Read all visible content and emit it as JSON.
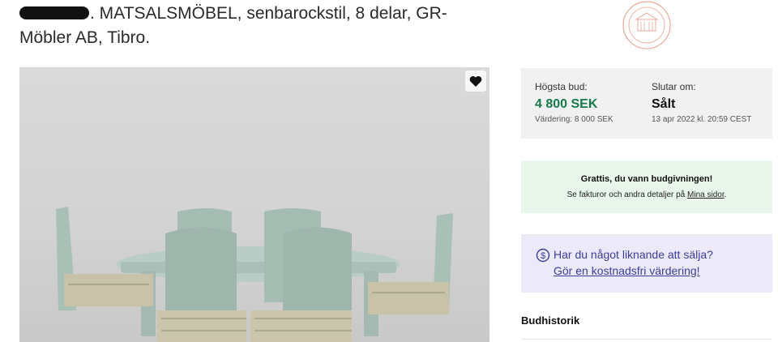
{
  "listing": {
    "title_line1": ". MATSALSMÖBEL, senbarockstil, 8 delar, GR-",
    "title_line2": "Möbler AB, Tibro."
  },
  "bid_box": {
    "highest_label": "Högsta bud:",
    "highest_value": "4 800 SEK",
    "valuation": "Värdering: 8 000 SEK",
    "ends_label": "Slutar om:",
    "ends_value": "Sålt",
    "ends_date": "13 apr 2022 kl. 20:59 CEST"
  },
  "win_box": {
    "heading": "Grattis, du vann budgivningen!",
    "text": "Se fakturor och andra detaljer på",
    "link": "Mina sidor",
    "suffix": "."
  },
  "sell_box": {
    "question": "Har du något liknande att sälja?",
    "link": "Gör en kostnadsfri värdering!",
    "icon": "dollar-circle-icon"
  },
  "bid_history": {
    "label": "Budhistorik"
  },
  "icons": {
    "favorite": "heart-icon",
    "seal": "auction-house-seal-logo"
  },
  "colors": {
    "price_green": "#16794a",
    "win_bg": "#e9f6ec",
    "sell_bg": "#eceaf8",
    "link_purple": "#3c3c9a"
  }
}
